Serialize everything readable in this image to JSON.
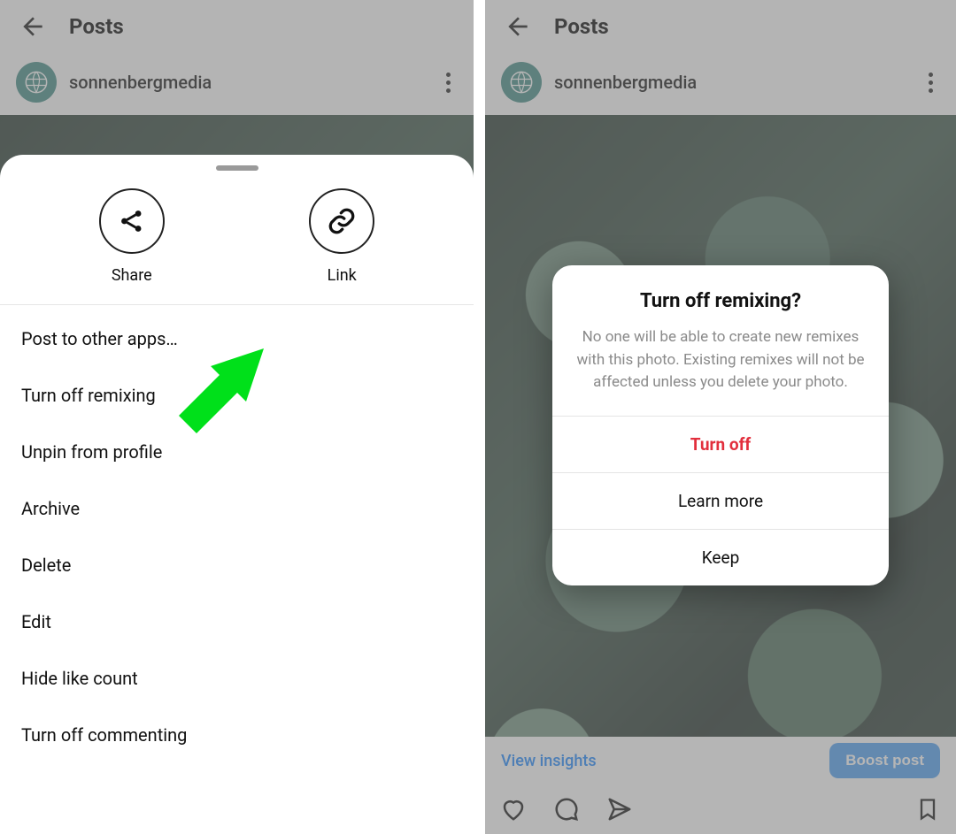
{
  "left": {
    "header": {
      "title": "Posts"
    },
    "user": {
      "name": "sonnenbergmedia"
    },
    "sheet": {
      "share_label": "Share",
      "link_label": "Link",
      "items": [
        "Post to other apps…",
        "Turn off remixing",
        "Unpin from profile",
        "Archive",
        "Delete",
        "Edit",
        "Hide like count",
        "Turn off commenting"
      ]
    }
  },
  "right": {
    "header": {
      "title": "Posts"
    },
    "user": {
      "name": "sonnenbergmedia"
    },
    "dialog": {
      "title": "Turn off remixing?",
      "message": "No one will be able to create new remixes with this photo. Existing remixes will not be affected unless you delete your photo.",
      "turn_off": "Turn off",
      "learn_more": "Learn more",
      "keep": "Keep"
    },
    "actions": {
      "view_insights": "View insights",
      "boost": "Boost post"
    }
  }
}
